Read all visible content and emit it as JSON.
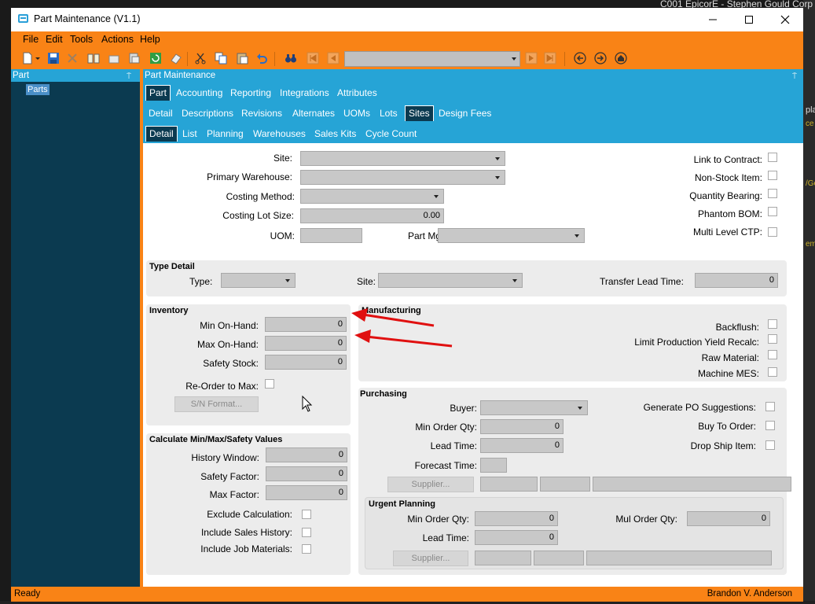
{
  "window": {
    "title": "Part Maintenance (V1.1)",
    "background_title": "C001 EpicorE - Stephen Gould Corp"
  },
  "menu": [
    "File",
    "Edit",
    "Tools",
    "Actions",
    "Help"
  ],
  "panels": {
    "left_title": "Part",
    "right_title": "Part Maintenance",
    "tree_item": "Parts"
  },
  "tabs": {
    "level1": [
      "Part",
      "Accounting",
      "Reporting",
      "Integrations",
      "Attributes"
    ],
    "level2": [
      "Detail",
      "Descriptions",
      "Revisions",
      "Alternates",
      "UOMs",
      "Lots",
      "Sites",
      "Design Fees"
    ],
    "level3": [
      "Detail",
      "List",
      "Planning",
      "Warehouses",
      "Sales Kits",
      "Cycle Count"
    ]
  },
  "site_section": {
    "site_label": "Site:",
    "primary_warehouse_label": "Primary Warehouse:",
    "costing_method_label": "Costing Method:",
    "costing_lot_size_label": "Costing Lot Size:",
    "costing_lot_size_value": "0.00",
    "uom_label": "UOM:",
    "part_mgr_label": "Part Mgr",
    "link_to_contract": "Link to Contract:",
    "non_stock_item": "Non-Stock Item:",
    "quantity_bearing": "Quantity Bearing:",
    "phantom_bom": "Phantom BOM:",
    "multi_level_ctp": "Multi Level CTP:"
  },
  "type_detail": {
    "title": "Type Detail",
    "type_label": "Type:",
    "site_label": "Site:",
    "transfer_lead_time_label": "Transfer Lead Time:",
    "transfer_lead_time_value": "0"
  },
  "inventory": {
    "title": "Inventory",
    "min_on_hand_label": "Min On-Hand:",
    "min_on_hand_value": "0",
    "max_on_hand_label": "Max On-Hand:",
    "max_on_hand_value": "0",
    "safety_stock_label": "Safety Stock:",
    "safety_stock_value": "0",
    "reorder_to_max_label": "Re-Order to Max:",
    "sn_format_button": "S/N Format..."
  },
  "calc": {
    "title": "Calculate Min/Max/Safety Values",
    "history_window_label": "History Window:",
    "history_window_value": "0",
    "safety_factor_label": "Safety Factor:",
    "safety_factor_value": "0",
    "max_factor_label": "Max Factor:",
    "max_factor_value": "0",
    "exclude_calc_label": "Exclude Calculation:",
    "include_sales_label": "Include Sales History:",
    "include_job_label": "Include Job Materials:"
  },
  "manufacturing": {
    "title": "Manufacturing",
    "backflush": "Backflush:",
    "limit_yield": "Limit Production Yield Recalc:",
    "raw_material": "Raw Material:",
    "machine_mes": "Machine MES:"
  },
  "purchasing": {
    "title": "Purchasing",
    "buyer_label": "Buyer:",
    "min_order_qty_label": "Min Order Qty:",
    "min_order_qty_value": "0",
    "lead_time_label": "Lead Time:",
    "lead_time_value": "0",
    "forecast_time_label": "Forecast Time:",
    "supplier_button": "Supplier...",
    "generate_po_label": "Generate PO Suggestions:",
    "buy_to_order_label": "Buy To Order:",
    "drop_ship_label": "Drop Ship Item:"
  },
  "urgent_planning": {
    "title": "Urgent Planning",
    "min_order_qty_label": "Min Order Qty:",
    "min_order_qty_value": "0",
    "lead_time_label": "Lead Time:",
    "lead_time_value": "0",
    "mul_order_qty_label": "Mul Order Qty:",
    "mul_order_qty_value": "0",
    "supplier_button": "Supplier..."
  },
  "status": {
    "left": "Ready",
    "right": "Brandon V. Anderson"
  },
  "colors": {
    "accent_orange": "#f98316",
    "header_blue": "#26a4d6",
    "dark_navy": "#0b3a50",
    "annotation_red": "#e01010"
  }
}
